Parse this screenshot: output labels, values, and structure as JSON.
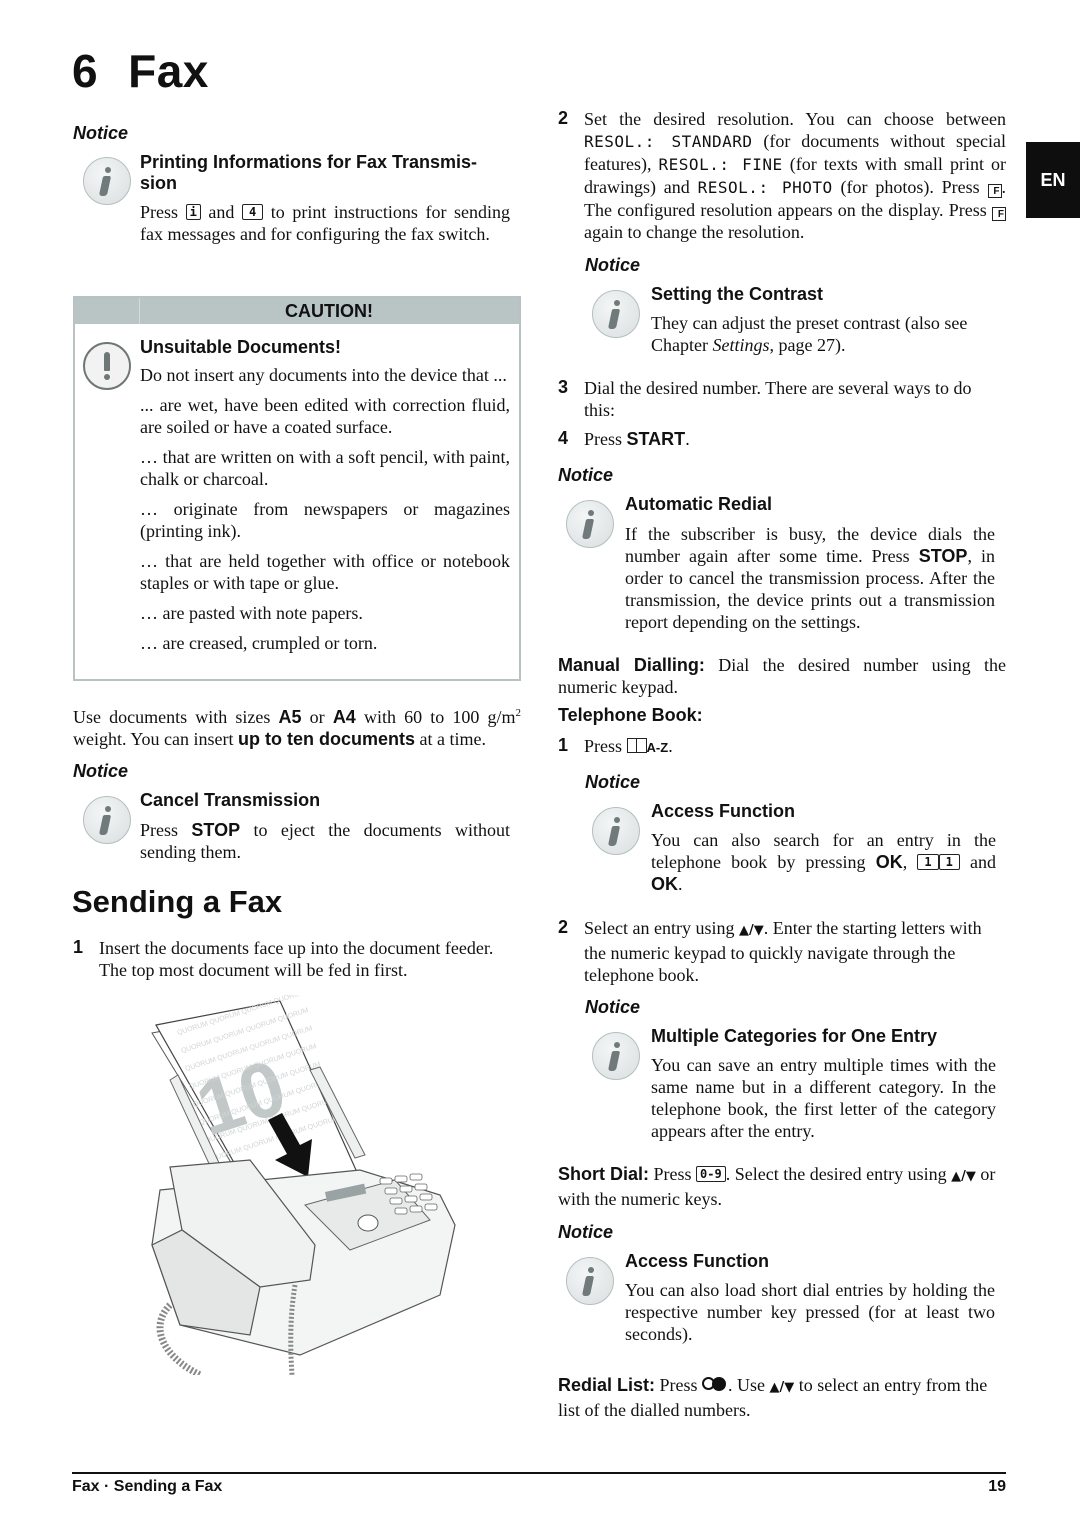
{
  "chapter": {
    "number": "6",
    "title": "Fax"
  },
  "language_tab": "EN",
  "left": {
    "notice1": {
      "label": "Notice",
      "heading_line1": "Printing Informations for Fax Transmis-",
      "heading_line2": "sion",
      "text_pre": "Press",
      "key1": "i",
      "text_mid": "and",
      "key2": "4",
      "text_post": "to print instructions for sending fax messages and for configuring the fax switch."
    },
    "caution": {
      "title": "CAUTION!",
      "heading": "Unsuitable Documents!",
      "intro": "Do not insert any documents into the device that ...",
      "items": [
        "... are wet, have been edited with correction fluid, are soiled or have a coated surface.",
        "… that are written on with a soft pencil, with paint, chalk or charcoal.",
        "… originate from newspapers or magazines (printing ink).",
        "… that are held together with office or notebook staples or with tape or glue.",
        "… are pasted with note papers.",
        "… are creased, crumpled or torn."
      ]
    },
    "sizes": {
      "t1": "Use documents with sizes",
      "a5": "A5",
      "t2": "or",
      "a4": "A4",
      "t3": "with 60 to 100 g/m",
      "sup": "2",
      "t4": "weight. You can insert",
      "bold": "up to ten documents",
      "t5": "at a time."
    },
    "notice2": {
      "label": "Notice",
      "heading": "Cancel Transmission",
      "t1": "Press",
      "stop": "STOP",
      "t2": "to eject the documents without sending them."
    },
    "section_title": "Sending a Fax",
    "step1": {
      "num": "1",
      "text": "Insert the documents face up into the document feeder. The top most document will be fed in first."
    },
    "illustration": {
      "doc_number": "10",
      "doc_text": "QUORUM QUORUM QUORUM QUORUM"
    }
  },
  "right": {
    "step2": {
      "num": "2",
      "t1": "Set the desired resolution. You can choose between",
      "lcd1": "RESOL.: STANDARD",
      "t2": "(for documents without special features),",
      "lcd2": "RESOL.: FINE",
      "t3": "(for texts with small print or drawings) and",
      "lcd3": "RESOL.: PHOTO",
      "t4": "(for photos). Press",
      "key": "F",
      "t5": ". The configured resolution appears on the display. Press",
      "t6": "again to change the resolution."
    },
    "notice_contrast": {
      "label": "Notice",
      "heading": "Setting the Contrast",
      "t1": "They can adjust the preset contrast (also see Chapter",
      "italic": "Settings",
      "t2": ", page 27)."
    },
    "step3": {
      "num": "3",
      "text": "Dial the desired number. There are several ways to do this:"
    },
    "step4": {
      "num": "4",
      "t1": "Press",
      "bold": "START",
      "t2": "."
    },
    "notice_redial": {
      "label": "Notice",
      "heading": "Automatic Redial",
      "t1": "If the subscriber is busy, the device dials the number again after some time. Press",
      "stop": "STOP",
      "t2": ", in order to cancel the transmission process. After the transmission, the device prints out a transmission report depending on the settings."
    },
    "manual": {
      "label": "Manual Dialling:",
      "text": "Dial the desired number using the numeric keypad."
    },
    "phonebook": {
      "label": "Telephone Book:",
      "step1_num": "1",
      "step1_t1": "Press",
      "step1_key": "A-Z",
      "step1_t2": "."
    },
    "notice_access1": {
      "label": "Notice",
      "heading": "Access Function",
      "t1": "You can also search for an entry in the telephone book by pressing",
      "ok1": "OK",
      "key1": "1",
      "key2": "1",
      "t2": "and",
      "ok2": "OK",
      "t3": "."
    },
    "step2b": {
      "num": "2",
      "t1": "Select an entry using",
      "arrows": "▲/▼",
      "t2": ". Enter the starting letters with the numeric keypad to quickly navigate through the telephone book."
    },
    "notice_categories": {
      "label": "Notice",
      "heading": "Multiple Categories for One Entry",
      "text": "You can save an entry multiple times with the same name but in a different category. In the telephone book, the first letter of the category appears after the entry."
    },
    "short_dial": {
      "label": "Short Dial:",
      "t1": "Press",
      "key": "0-9",
      "t2": ". Select the desired entry using",
      "arrows": "▲/▼",
      "t3": "or with the numeric keys."
    },
    "notice_access2": {
      "label": "Notice",
      "heading": "Access Function",
      "text": "You can also load short dial entries by holding the respective number key pressed (for at least two seconds)."
    },
    "redial_list": {
      "label": "Redial List:",
      "t1": "Press",
      "t2": ". Use",
      "arrows": "▲/▼",
      "t3": "to select an entry from the list of the dialled numbers."
    }
  },
  "footer": {
    "left": "Fax · Sending a Fax",
    "page": "19"
  }
}
